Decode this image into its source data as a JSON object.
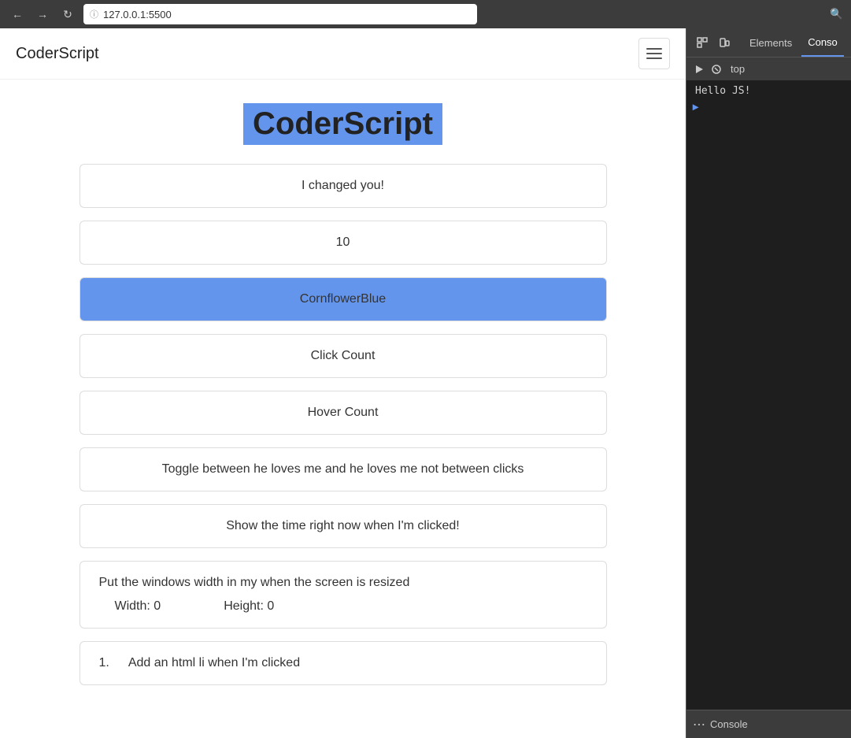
{
  "browser": {
    "url": "127.0.0.1:5500",
    "back_disabled": false,
    "forward_disabled": false
  },
  "navbar": {
    "brand": "CoderScript",
    "hamburger_label": "Menu"
  },
  "page": {
    "title": "CoderScript",
    "cards": [
      {
        "id": "text-card",
        "text": "I changed you!"
      },
      {
        "id": "number-card",
        "text": "10"
      },
      {
        "id": "color-card",
        "text": "CornflowerBlue",
        "blue": true
      },
      {
        "id": "click-count-card",
        "text": "Click Count"
      },
      {
        "id": "hover-count-card",
        "text": "Hover Count"
      },
      {
        "id": "toggle-card",
        "text": "Toggle between he loves me and he loves me not between clicks"
      },
      {
        "id": "time-card",
        "text": "Show the time right now when I'm clicked!"
      },
      {
        "id": "resize-card",
        "heading": "Put the windows width in my when the screen is resized",
        "width_label": "Width: 0",
        "height_label": "Height: 0"
      },
      {
        "id": "list-card",
        "number": "1.",
        "text": "Add an html li when I'm clicked"
      }
    ]
  },
  "devtools": {
    "tabs": [
      {
        "label": "Elements",
        "active": false
      },
      {
        "label": "Conso",
        "active": true
      }
    ],
    "top_label": "top",
    "console_output": "Hello JS!",
    "bottom_label": "Console"
  }
}
